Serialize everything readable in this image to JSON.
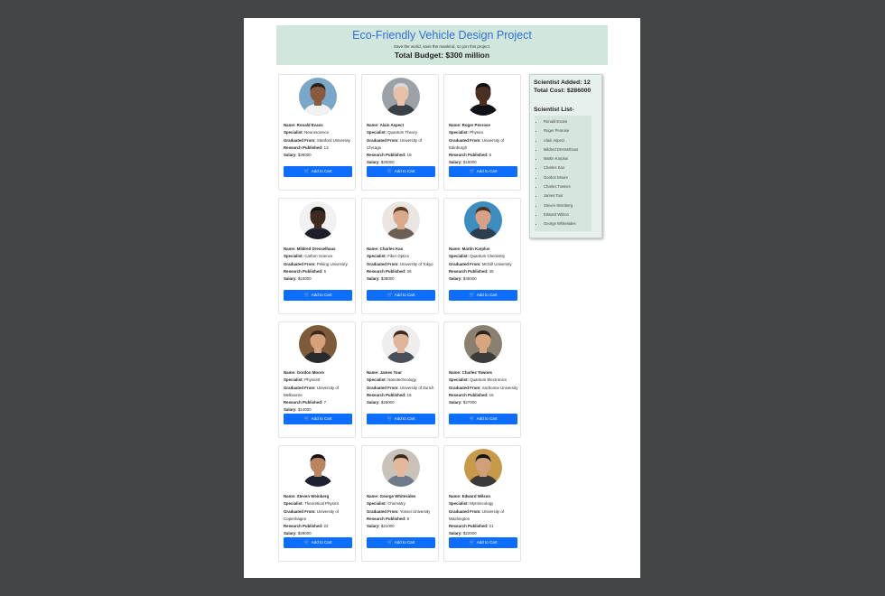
{
  "header": {
    "title": "Eco-Friendly Vehicle Design Project",
    "subtitle": "Save the world, save the mankind, so join this project.",
    "budget": "Total Budget: $300 million"
  },
  "labels": {
    "name": "Name:",
    "specialist": "Specialist:",
    "graduated": "Graduated From:",
    "research": "Research Published:",
    "salary": "Salary:",
    "add_to_cart": "Add to Cart"
  },
  "scientists": [
    {
      "name": "Ronald Evans",
      "specialist": "Neuroscience",
      "graduated": "Stanford University",
      "research": "13",
      "salary": "$36000",
      "skin": "#8a5a3c",
      "hair": "#2b2118",
      "bg": "#7aa6c7",
      "shirt": "#f2f2f2"
    },
    {
      "name": "Alain Aspect",
      "specialist": "Quantum Theory",
      "graduated": "University of Chicago",
      "research": "19",
      "salary": "$20000",
      "skin": "#e8c1a6",
      "hair": "#d9d9d9",
      "bg": "#9aa2a8",
      "shirt": "#3a3f48"
    },
    {
      "name": "Roger Penrose",
      "specialist": "Physics",
      "graduated": "University of Edinburgh",
      "research": "6",
      "salary": "$18000",
      "skin": "#4a2f22",
      "hair": "#141010",
      "bg": "#ffffff",
      "shirt": "#101218"
    },
    {
      "name": "Mildred Dresselhaus",
      "specialist": "Carbon Science",
      "graduated": "Peking University",
      "research": "5",
      "salary": "$10000",
      "skin": "#3d2a20",
      "hair": "#141010",
      "bg": "#f1f1f1",
      "shirt": "#1c1f2a"
    },
    {
      "name": "Charles Kao",
      "specialist": "Fiber Optics",
      "graduated": "University of Tokyo",
      "research": "26",
      "salary": "$38000",
      "skin": "#d8a98a",
      "hair": "#5a3a24",
      "bg": "#e9e6e2",
      "shirt": "#6b5f56"
    },
    {
      "name": "Martin Karplus",
      "specialist": "Quantum Chemistry",
      "graduated": "McGill University",
      "research": "35",
      "salary": "$40000",
      "skin": "#d9a084",
      "hair": "#4a3426",
      "bg": "#3c8ec0",
      "shirt": "#2c3e50"
    },
    {
      "name": "Gordon Moore",
      "specialist": "Physicist",
      "graduated": "University of Melbourne",
      "research": "7",
      "salary": "$14000",
      "skin": "#d6a27e",
      "hair": "#3a2a1e",
      "bg": "#7d5a3a",
      "shirt": "#2a2a2a"
    },
    {
      "name": "James Tour",
      "specialist": "Nanotechnology",
      "graduated": "University of Zurich",
      "research": "15",
      "salary": "$25000",
      "skin": "#e0b498",
      "hair": "#3a2a22",
      "bg": "#eeeeee",
      "shirt": "#4a5058"
    },
    {
      "name": "Charles Townes",
      "specialist": "Quantum Electronics",
      "graduated": "Sorbonne University",
      "research": "16",
      "salary": "$27000",
      "skin": "#d7a67f",
      "hair": "#2a221c",
      "bg": "#8a8070",
      "shirt": "#3b3b3b"
    },
    {
      "name": "Steven Weinberg",
      "specialist": "Theoretical Physics",
      "graduated": "University of Copenhagen",
      "research": "22",
      "salary": "$29000",
      "skin": "#b98561",
      "hair": "#141010",
      "bg": "#ffffff",
      "shirt": "#1e2230"
    },
    {
      "name": "George Whitesides",
      "specialist": "Chemistry",
      "graduated": "Yonsei University",
      "research": "8",
      "salary": "$21000",
      "skin": "#e3b89c",
      "hair": "#3a2a1e",
      "bg": "#c9c2b8",
      "shirt": "#6e7a8a"
    },
    {
      "name": "Edward Wilson",
      "specialist": "Myrmecology",
      "graduated": "University of Washington",
      "research": "21",
      "salary": "$22000",
      "skin": "#d0a07c",
      "hair": "#151212",
      "bg": "#c79a4a",
      "shirt": "#3a3a3a"
    }
  ],
  "sidebar": {
    "added": "Scientist Added: 12",
    "cost": "Total Cost: $286000",
    "list_title": "Scientist List-",
    "list": [
      "Ronald Evans",
      "Roger Penrose",
      "Alain Aspect",
      "Mildred Dresselhaus",
      "Martin Karplus",
      "Charles Kao",
      "Gordon Moore",
      "Charles Townes",
      "James Tour",
      "Steven Weinberg",
      "Edward Wilson",
      "George Whitesides"
    ]
  },
  "colors": {
    "header_bg": "#d1e7dd",
    "title": "#2f6fd6",
    "button": "#0d6efd",
    "sidebar_bg": "#e7f0ec",
    "backdrop": "#444546"
  },
  "icons": {
    "cart": "cart-icon",
    "avatar": "avatar-photo"
  }
}
